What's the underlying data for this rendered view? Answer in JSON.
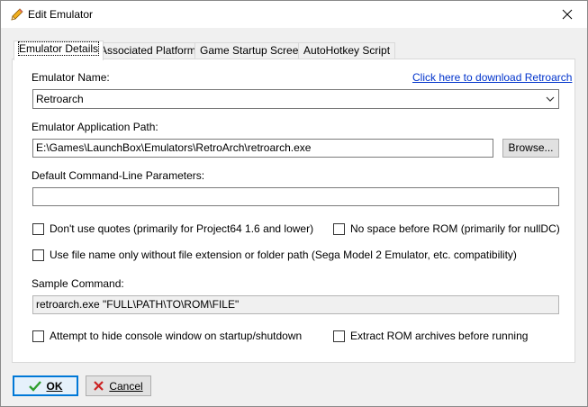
{
  "window": {
    "title": "Edit Emulator"
  },
  "tabs": [
    {
      "label": "Emulator Details",
      "active": true
    },
    {
      "label": "Associated Platforms"
    },
    {
      "label": "Game Startup Screen"
    },
    {
      "label": "AutoHotkey Script"
    }
  ],
  "details": {
    "emulator_name_label": "Emulator Name:",
    "download_link": "Click here to download Retroarch",
    "emulator_name_value": "Retroarch",
    "app_path_label": "Emulator Application Path:",
    "app_path_value": "E:\\Games\\LaunchBox\\Emulators\\RetroArch\\retroarch.exe",
    "browse_label": "Browse...",
    "cmdline_label": "Default Command-Line Parameters:",
    "cmdline_value": "",
    "dont_use_quotes": "Don't use quotes (primarily for Project64 1.6 and lower)",
    "no_space_before_rom": "No space before ROM (primarily for nullDC)",
    "file_name_only": "Use file name only without file extension or folder path (Sega Model 2 Emulator, etc. compatibility)",
    "sample_command_label": "Sample Command:",
    "sample_command_value": "retroarch.exe \"FULL\\PATH\\TO\\ROM\\FILE\"",
    "hide_console": "Attempt to hide console window on startup/shutdown",
    "extract_archives": "Extract ROM archives before running"
  },
  "footer": {
    "ok_label": "OK",
    "cancel_label": "Cancel"
  },
  "colors": {
    "link": "#0033cc",
    "ok_check": "#2e9e2e",
    "cancel_x": "#cc2222",
    "accent": "#0078d7"
  }
}
